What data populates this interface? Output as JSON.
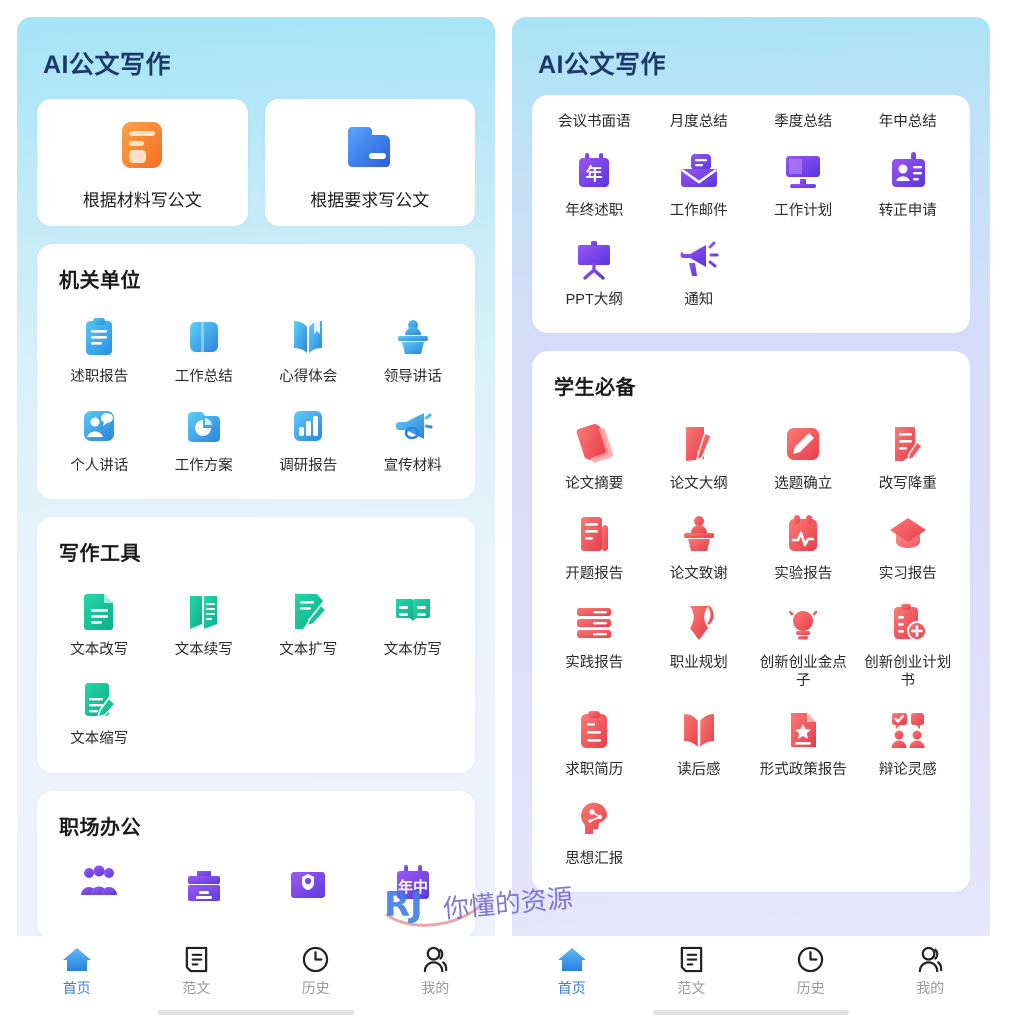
{
  "watermark": {
    "brand": "RJ",
    "text": "你懂的资源"
  },
  "left_phone": {
    "header_title": "AI公文写作",
    "entries": [
      {
        "label": "根据材料写公文",
        "icon": "orange-document-icon"
      },
      {
        "label": "根据要求写公文",
        "icon": "blue-folder-icon"
      }
    ],
    "sections": [
      {
        "title": "机关单位",
        "items": [
          {
            "label": "述职报告",
            "icon": "clipboard-icon"
          },
          {
            "label": "工作总结",
            "icon": "book-cover-icon"
          },
          {
            "label": "心得体会",
            "icon": "open-book-icon"
          },
          {
            "label": "领导讲话",
            "icon": "podium-speaker-icon"
          },
          {
            "label": "个人讲话",
            "icon": "person-speech-icon"
          },
          {
            "label": "工作方案",
            "icon": "pie-folder-icon"
          },
          {
            "label": "调研报告",
            "icon": "bar-chart-icon"
          },
          {
            "label": "宣传材料",
            "icon": "megaphone-icon"
          }
        ]
      },
      {
        "title": "写作工具",
        "items": [
          {
            "label": "文本改写",
            "icon": "document-lines-icon"
          },
          {
            "label": "文本续写",
            "icon": "open-pages-icon"
          },
          {
            "label": "文本扩写",
            "icon": "document-pencil-icon"
          },
          {
            "label": "文本仿写",
            "icon": "open-book-dashes-icon"
          },
          {
            "label": "文本缩写",
            "icon": "document-pen-icon"
          }
        ]
      },
      {
        "title": "职场办公",
        "items": [
          {
            "label": "",
            "icon": "people-group-icon"
          },
          {
            "label": "",
            "icon": "toolbox-icon"
          },
          {
            "label": "",
            "icon": "safe-box-icon"
          },
          {
            "label": "",
            "icon": "midyear-calendar-icon"
          }
        ]
      }
    ],
    "tabs": [
      {
        "label": "首页",
        "icon": "home-icon",
        "active": true
      },
      {
        "label": "范文",
        "icon": "document-icon",
        "active": false
      },
      {
        "label": "历史",
        "icon": "clock-icon",
        "active": false
      },
      {
        "label": "我的",
        "icon": "user-icon",
        "active": false
      }
    ]
  },
  "right_phone": {
    "header_title": "AI公文写作",
    "sections": [
      {
        "title": "",
        "orphan_labels": [
          "会议书面语",
          "月度总结",
          "季度总结",
          "年中总结"
        ],
        "items": [
          {
            "label": "年终述职",
            "icon": "year-calendar-icon"
          },
          {
            "label": "工作邮件",
            "icon": "mail-message-icon"
          },
          {
            "label": "工作计划",
            "icon": "monitor-icon"
          },
          {
            "label": "转正申请",
            "icon": "id-badge-icon"
          },
          {
            "label": "PPT大纲",
            "icon": "presentation-board-icon"
          },
          {
            "label": "通知",
            "icon": "megaphone-purple-icon"
          }
        ]
      },
      {
        "title": "学生必备",
        "items": [
          {
            "label": "论文摘要",
            "icon": "paper-stack-icon"
          },
          {
            "label": "论文大纲",
            "icon": "paper-pen-icon"
          },
          {
            "label": "选题确立",
            "icon": "square-pencil-icon"
          },
          {
            "label": "改写降重",
            "icon": "edit-lines-icon"
          },
          {
            "label": "开题报告",
            "icon": "scroll-report-icon"
          },
          {
            "label": "论文致谢",
            "icon": "podium-thanks-icon"
          },
          {
            "label": "实验报告",
            "icon": "lab-clipboard-icon"
          },
          {
            "label": "实习报告",
            "icon": "graduation-cap-icon"
          },
          {
            "label": "实践报告",
            "icon": "list-rows-icon"
          },
          {
            "label": "职业规划",
            "icon": "flag-career-icon"
          },
          {
            "label": "创新创业金点子",
            "icon": "lightbulb-idea-icon"
          },
          {
            "label": "创新创业计划书",
            "icon": "clipboard-plus-icon"
          },
          {
            "label": "求职简历",
            "icon": "resume-clipboard-icon"
          },
          {
            "label": "读后感",
            "icon": "open-book-red-icon"
          },
          {
            "label": "形式政策报告",
            "icon": "star-document-icon"
          },
          {
            "label": "辩论灵感",
            "icon": "debate-icon"
          },
          {
            "label": "思想汇报",
            "icon": "brain-head-icon"
          }
        ]
      }
    ],
    "tabs": [
      {
        "label": "首页",
        "icon": "home-icon",
        "active": true
      },
      {
        "label": "范文",
        "icon": "document-icon",
        "active": false
      },
      {
        "label": "历史",
        "icon": "clock-icon",
        "active": false
      },
      {
        "label": "我的",
        "icon": "user-icon",
        "active": false
      }
    ]
  },
  "colors": {
    "left_bg_top": "#a5e4f7",
    "right_bg_bottom": "#e9e9fd",
    "title": "#1b3a6b",
    "blue_icon": "#3aa7e8",
    "green_icon": "#18c39a",
    "purple_icon": "#7b46e0",
    "red_icon": "#f4635e",
    "orange_icon": "#f5812f",
    "tab_active": "#3d7fd6",
    "tab_inactive": "#9a9a9a"
  }
}
